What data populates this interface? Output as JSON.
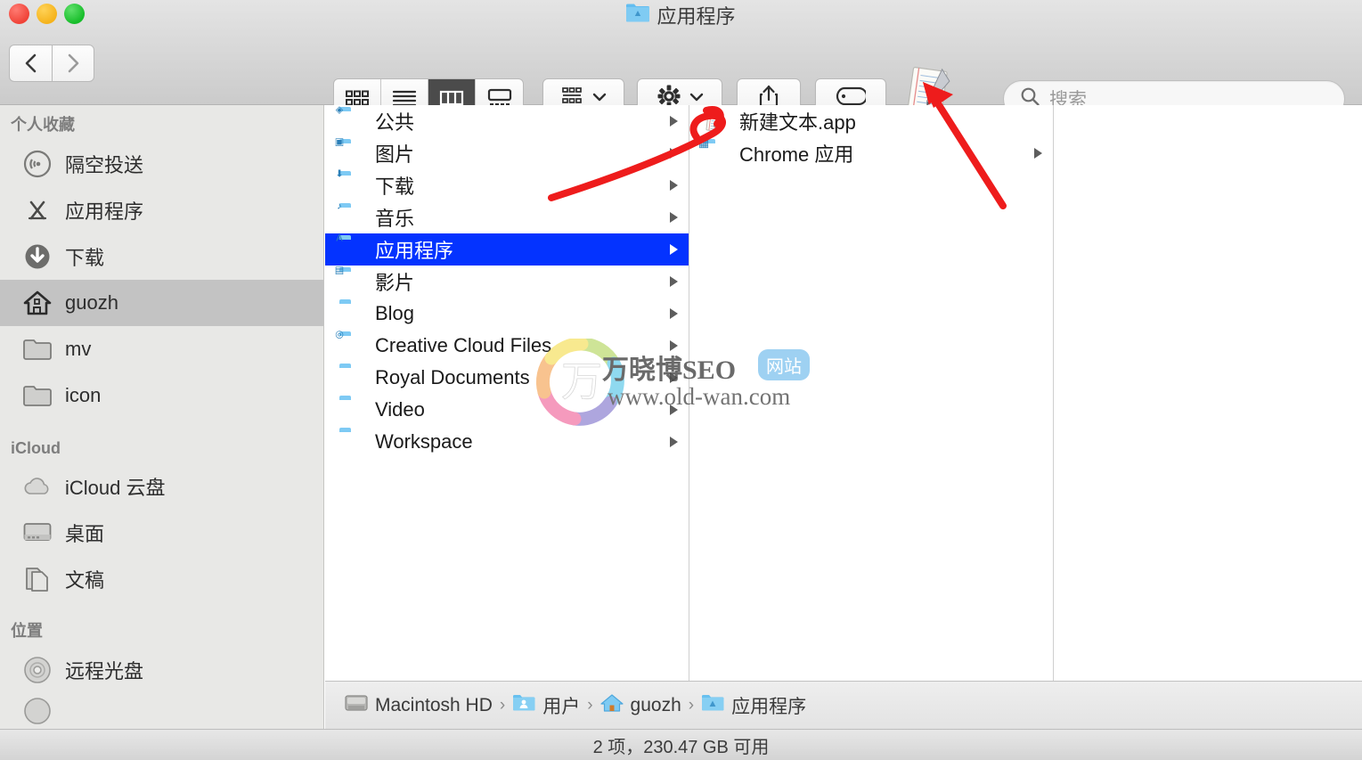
{
  "window": {
    "title": "应用程序",
    "title_icon": "applications-folder-icon",
    "traffic_lights": {
      "close": "close-button",
      "minimize": "minimize-button",
      "zoom": "zoom-button"
    }
  },
  "toolbar": {
    "back_label": "‹",
    "forward_label": "›",
    "view_modes": [
      {
        "name": "icon-view",
        "label": "icon",
        "active": false
      },
      {
        "name": "list-view",
        "label": "list",
        "active": false
      },
      {
        "name": "column-view",
        "label": "column",
        "active": true
      },
      {
        "name": "gallery-view",
        "label": "gallery",
        "active": false
      }
    ],
    "arrange_label": "arrange",
    "action_label": "action",
    "share_label": "share",
    "tags_label": "tags",
    "drag_item_label": "新建文本.app"
  },
  "search": {
    "placeholder": "搜索",
    "value": ""
  },
  "sidebar": {
    "sections": [
      {
        "header": "个人收藏",
        "items": [
          {
            "label": "隔空投送",
            "icon": "airdrop-icon",
            "selected": false
          },
          {
            "label": "应用程序",
            "icon": "applications-icon",
            "selected": false
          },
          {
            "label": "下载",
            "icon": "downloads-icon",
            "selected": false
          },
          {
            "label": "guozh",
            "icon": "home-icon",
            "selected": true
          },
          {
            "label": "mv",
            "icon": "folder-icon",
            "selected": false
          },
          {
            "label": "icon",
            "icon": "folder-icon",
            "selected": false
          }
        ]
      },
      {
        "header": "iCloud",
        "items": [
          {
            "label": "iCloud 云盘",
            "icon": "cloud-icon",
            "selected": false
          },
          {
            "label": "桌面",
            "icon": "desktop-icon",
            "selected": false
          },
          {
            "label": "文稿",
            "icon": "documents-icon",
            "selected": false
          }
        ]
      },
      {
        "header": "位置",
        "items": [
          {
            "label": "远程光盘",
            "icon": "disc-icon",
            "selected": false
          }
        ]
      }
    ]
  },
  "columns": [
    {
      "name": "column-1",
      "rows": [
        {
          "label": "公共",
          "icon": "public-folder-icon",
          "badge": "◈",
          "disclosure": true,
          "selected": false
        },
        {
          "label": "图片",
          "icon": "pictures-folder-icon",
          "badge": "▣",
          "disclosure": true,
          "selected": false
        },
        {
          "label": "下载",
          "icon": "downloads-folder-icon",
          "badge": "⬇",
          "disclosure": true,
          "selected": false
        },
        {
          "label": "音乐",
          "icon": "music-folder-icon",
          "badge": "♪",
          "disclosure": true,
          "selected": false
        },
        {
          "label": "应用程序",
          "icon": "applications-folder-icon",
          "badge": "A",
          "disclosure": true,
          "selected": true
        },
        {
          "label": "影片",
          "icon": "movies-folder-icon",
          "badge": "▤",
          "disclosure": true,
          "selected": false
        },
        {
          "label": "Blog",
          "icon": "folder-icon",
          "badge": "",
          "disclosure": true,
          "selected": false
        },
        {
          "label": "Creative Cloud Files",
          "icon": "creative-cloud-folder-icon",
          "badge": "◎",
          "disclosure": true,
          "selected": false
        },
        {
          "label": "Royal Documents",
          "icon": "folder-icon",
          "badge": "",
          "disclosure": true,
          "selected": false
        },
        {
          "label": "Video",
          "icon": "folder-icon",
          "badge": "",
          "disclosure": true,
          "selected": false
        },
        {
          "label": "Workspace",
          "icon": "folder-icon",
          "badge": "",
          "disclosure": true,
          "selected": false
        }
      ]
    },
    {
      "name": "column-2",
      "rows": [
        {
          "label": "新建文本.app",
          "icon": "textedit-app-icon",
          "badge": "",
          "disclosure": false,
          "selected": false
        },
        {
          "label": "Chrome 应用",
          "icon": "chrome-apps-folder-icon",
          "badge": "▦",
          "disclosure": true,
          "selected": false
        }
      ]
    },
    {
      "name": "column-3",
      "rows": []
    }
  ],
  "pathbar": {
    "separator": "›",
    "crumbs": [
      {
        "label": "Macintosh HD",
        "icon": "harddisk-icon"
      },
      {
        "label": "用户",
        "icon": "users-folder-icon"
      },
      {
        "label": "guozh",
        "icon": "home-folder-icon"
      },
      {
        "label": "应用程序",
        "icon": "applications-folder-icon"
      }
    ]
  },
  "statusbar": {
    "text": "2 项，230.47 GB 可用"
  },
  "watermark": {
    "line1": "万晓博SEO",
    "badge": "网站",
    "line2": "www.old-wan.com",
    "logo_char": "万"
  },
  "annotations": {
    "arrow_color": "#ee1c1c",
    "arrow1_target": "新建文本.app",
    "arrow2_target": "drag-item-icon"
  },
  "colors": {
    "selection_blue": "#0433ff",
    "sidebar_bg": "#e8e8e6",
    "toolbar_bg": "#d6d6d6",
    "folder_blue": "#57b9ee",
    "annotation_red": "#ee1c1c"
  }
}
